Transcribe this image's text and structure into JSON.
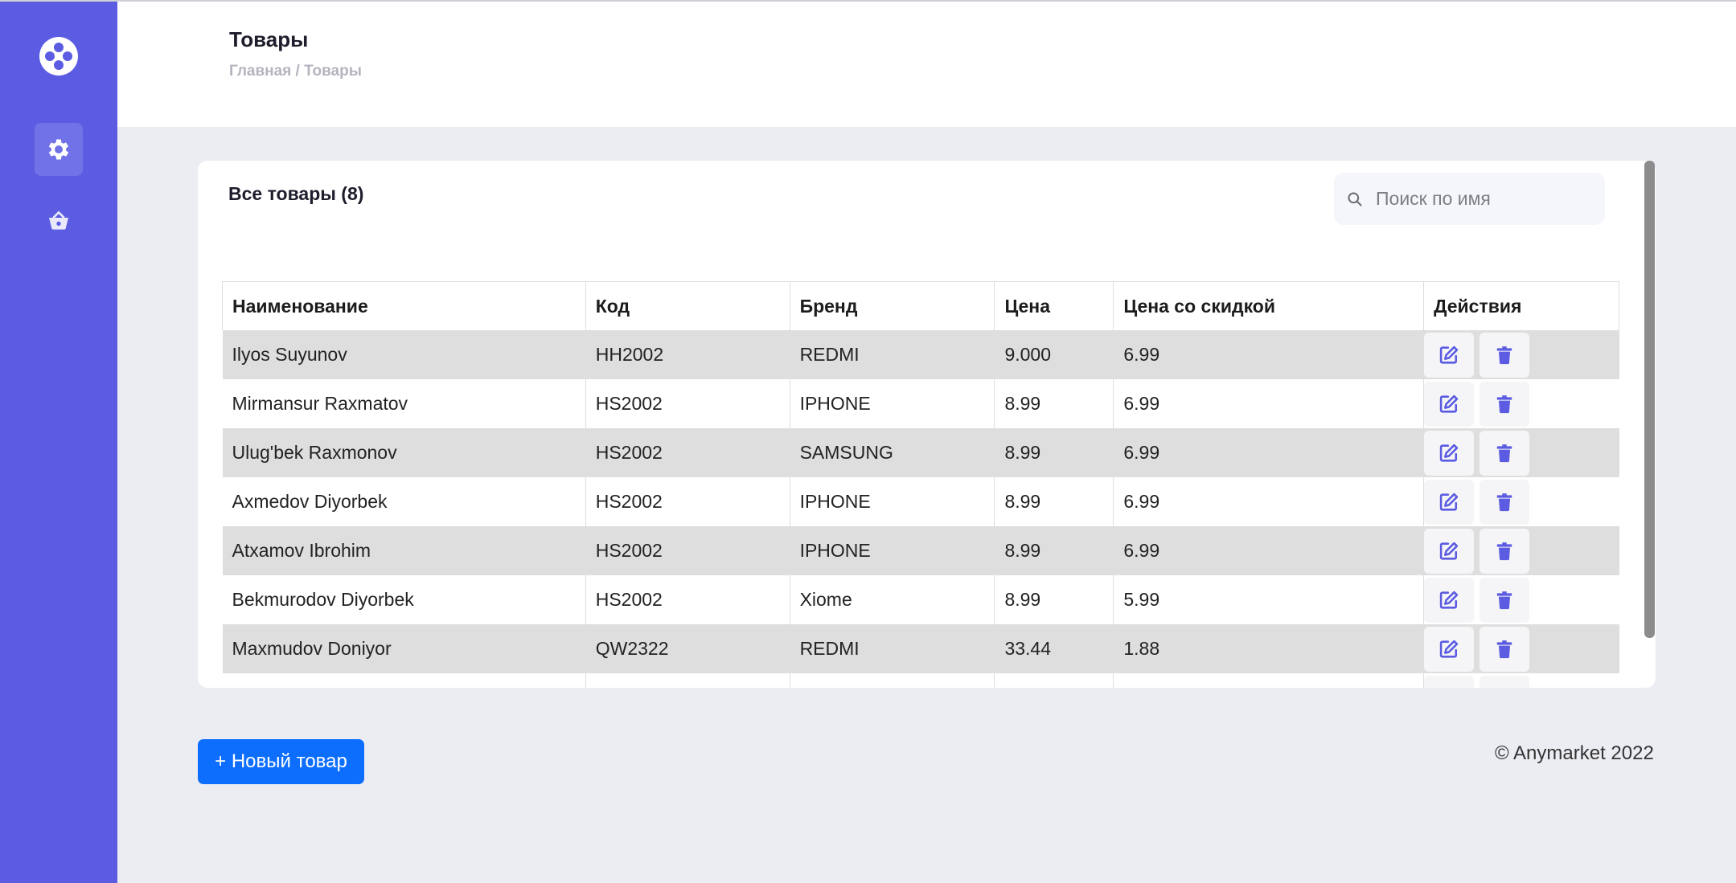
{
  "header": {
    "title": "Товары",
    "breadcrumb": "Главная / Товары"
  },
  "sidebar": {
    "items": [
      {
        "icon": "gear-icon",
        "active": true
      },
      {
        "icon": "basket-icon",
        "active": false
      }
    ]
  },
  "card": {
    "title": "Все товары (8)"
  },
  "search": {
    "placeholder": "Поиск по имя",
    "value": ""
  },
  "table": {
    "columns": [
      "Наименование",
      "Код",
      "Бренд",
      "Цена",
      "Цена со скидкой",
      "Действия"
    ],
    "rows": [
      [
        "Ilyos Suyunov",
        "HH2002",
        "REDMI",
        "9.000",
        "6.99"
      ],
      [
        "Mirmansur Raxmatov",
        "HS2002",
        "IPHONE",
        "8.99",
        "6.99"
      ],
      [
        "Ulug'bek Raxmonov",
        "HS2002",
        "SAMSUNG",
        "8.99",
        "6.99"
      ],
      [
        "Axmedov Diyorbek",
        "HS2002",
        "IPHONE",
        "8.99",
        "6.99"
      ],
      [
        "Atxamov Ibrohim",
        "HS2002",
        "IPHONE",
        "8.99",
        "6.99"
      ],
      [
        "Bekmurodov Diyorbek",
        "HS2002",
        "Xiome",
        "8.99",
        "5.99"
      ],
      [
        "Maxmudov Doniyor",
        "QW2322",
        "REDMI",
        "33.44",
        "1.88"
      ],
      [
        "",
        "",
        "",
        "",
        ""
      ]
    ]
  },
  "add_button": {
    "label": "+ Новый товар"
  },
  "footer": {
    "text": "© Anymarket 2022"
  },
  "colors": {
    "sidebar": "#5b5ce2",
    "accent": "#0d6efd",
    "row_alt": "#dedede"
  }
}
